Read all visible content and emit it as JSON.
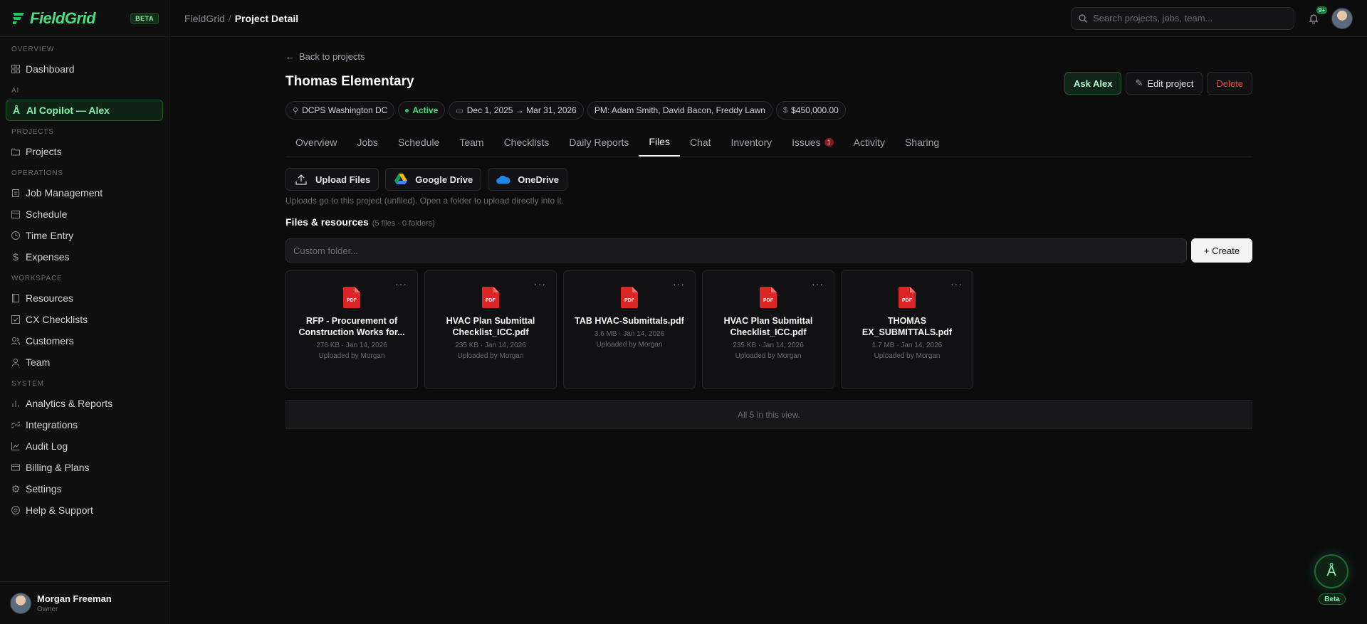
{
  "app": {
    "name": "FieldGrid",
    "beta": "BETA",
    "accent": "#4ade80"
  },
  "sidebar": {
    "sections": [
      {
        "label": "OVERVIEW",
        "items": [
          {
            "label": "Dashboard",
            "icon": "grid-icon"
          }
        ]
      },
      {
        "label": "AI",
        "items": [
          {
            "label": "AI Copilot — Alex",
            "icon": "copilot-icon"
          }
        ]
      },
      {
        "label": "PROJECTS",
        "items": [
          {
            "label": "Projects",
            "icon": "folder-icon"
          }
        ]
      },
      {
        "label": "OPERATIONS",
        "items": [
          {
            "label": "Job Management",
            "icon": "clipboard-icon"
          },
          {
            "label": "Schedule",
            "icon": "calendar-icon"
          },
          {
            "label": "Time Entry",
            "icon": "clock-icon"
          },
          {
            "label": "Expenses",
            "icon": "dollar-icon"
          }
        ]
      },
      {
        "label": "WORKSPACE",
        "items": [
          {
            "label": "Resources",
            "icon": "book-icon"
          },
          {
            "label": "CX Checklists",
            "icon": "checklist-icon"
          },
          {
            "label": "Customers",
            "icon": "users-icon"
          },
          {
            "label": "Team",
            "icon": "user-icon"
          }
        ]
      },
      {
        "label": "SYSTEM",
        "items": [
          {
            "label": "Analytics & Reports",
            "icon": "bar-chart-icon"
          },
          {
            "label": "Integrations",
            "icon": "link-icon"
          },
          {
            "label": "Audit Log",
            "icon": "line-chart-icon"
          },
          {
            "label": "Billing & Plans",
            "icon": "credit-card-icon"
          },
          {
            "label": "Settings",
            "icon": "gear-icon"
          },
          {
            "label": "Help & Support",
            "icon": "help-icon"
          }
        ]
      }
    ],
    "user": {
      "name": "Morgan Freeman",
      "role": "Owner"
    }
  },
  "topbar": {
    "breadcrumb_root": "FieldGrid",
    "breadcrumb_sep": "/",
    "breadcrumb_current": "Project Detail",
    "search_placeholder": "Search projects, jobs, team...",
    "notification_count": "9+"
  },
  "project": {
    "back_label": "Back to projects",
    "title": "Thomas Elementary",
    "actions": {
      "ask": "Ask Alex",
      "edit": "Edit project",
      "delete": "Delete"
    },
    "chips": {
      "client": "DCPS Washington DC",
      "status": "Active",
      "dates": "Dec 1, 2025 → Mar 31, 2026",
      "pm": "PM: Adam Smith, David Bacon, Freddy Lawn",
      "budget": "$450,000.00"
    },
    "tabs": [
      {
        "label": "Overview"
      },
      {
        "label": "Jobs"
      },
      {
        "label": "Schedule"
      },
      {
        "label": "Team"
      },
      {
        "label": "Checklists"
      },
      {
        "label": "Daily Reports"
      },
      {
        "label": "Files",
        "active": true
      },
      {
        "label": "Chat"
      },
      {
        "label": "Inventory"
      },
      {
        "label": "Issues",
        "badge": "1"
      },
      {
        "label": "Activity"
      },
      {
        "label": "Sharing"
      }
    ]
  },
  "files": {
    "upload_label": "Upload Files",
    "gdrive_label": "Google Drive",
    "onedrive_label": "OneDrive",
    "hint": "Uploads go to this project (unfiled). Open a folder to upload directly into it.",
    "section_title": "Files & resources",
    "section_count": "(5 files · 0 folders)",
    "folder_placeholder": "Custom folder...",
    "create_label": "+ Create",
    "items": [
      {
        "name": "RFP - Procurement of Construction Works for...",
        "meta": "276 KB · Jan 14, 2026",
        "uploader": "Uploaded by Morgan"
      },
      {
        "name": "HVAC Plan Submittal Checklist_ICC.pdf",
        "meta": "235 KB · Jan 14, 2026",
        "uploader": "Uploaded by Morgan"
      },
      {
        "name": "TAB HVAC-Submittals.pdf",
        "meta": "3.6 MB · Jan 14, 2026",
        "uploader": "Uploaded by Morgan"
      },
      {
        "name": "HVAC Plan Submittal Checklist_ICC.pdf",
        "meta": "235 KB · Jan 14, 2026",
        "uploader": "Uploaded by Morgan"
      },
      {
        "name": "THOMAS EX_SUBMITTALS.pdf",
        "meta": "1.7 MB · Jan 14, 2026",
        "uploader": "Uploaded by Morgan"
      }
    ],
    "footer": "All 5 in this view.",
    "pdf_label": "PDF"
  },
  "fab": {
    "label": "Beta"
  }
}
